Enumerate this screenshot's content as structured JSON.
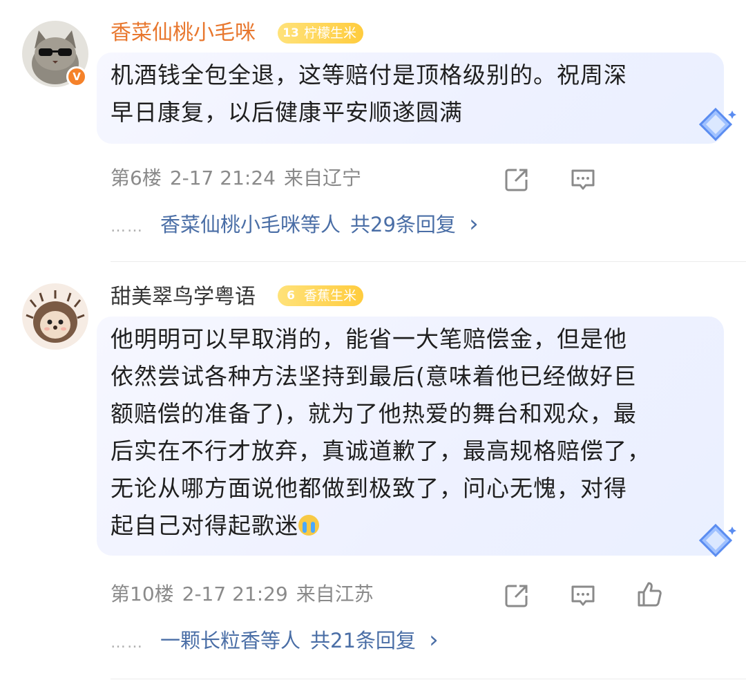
{
  "comments": [
    {
      "username": "香菜仙桃小毛咪",
      "username_color": "#e8772e",
      "level": "13",
      "badge_label": "柠檬生米",
      "verified_mark": "V",
      "text_lines": [
        "机酒钱全包全退，这等赔付是顶格级别的。祝周深",
        "早日康复，以后健康平安顺遂圆满"
      ],
      "floor": "第6楼",
      "time": "2-17 21:24",
      "location": "来自辽宁",
      "actions": [
        "share-icon",
        "comment-icon"
      ],
      "reply_users": "香菜仙桃小毛咪等人",
      "reply_total": "共29条回复",
      "reply_chevron": "›"
    },
    {
      "username": "甜美翠鸟学粤语",
      "username_color": "#333333",
      "level": "6",
      "badge_label": "香蕉生米",
      "text_lines": [
        "他明明可以早取消的，能省一大笔赔偿金，但是他",
        "依然尝试各种方法坚持到最后(意味着他已经做好巨",
        "额赔偿的准备了)，就为了他热爱的舞台和观众，最",
        "后实在不行才放弃，真诚道歉了，最高规格赔偿了，",
        "无论从哪方面说他都做到极致了，问心无愧，对得",
        "起自己对得起歌迷"
      ],
      "emoji": "crying-emoji",
      "floor": "第10楼",
      "time": "2-17 21:29",
      "location": "来自江苏",
      "actions": [
        "share-icon",
        "comment-icon",
        "like-icon"
      ],
      "reply_users": "一颗长粒香等人",
      "reply_total": "共21条回复",
      "reply_chevron": "›"
    }
  ],
  "reply_dots": "……",
  "colors": {
    "link": "#4a6ea6",
    "meta": "#8a8a8a",
    "badge": "#ffd24a",
    "verified": "#f5822a"
  }
}
